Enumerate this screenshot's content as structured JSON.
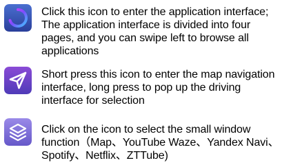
{
  "items": [
    {
      "icon": "app-launcher-icon",
      "lines": [
        "Click this icon to enter the application interface;",
        "The application interface is divided into four",
        "pages, and you can swipe left to browse all",
        "applications"
      ]
    },
    {
      "icon": "navigation-arrow-icon",
      "lines": [
        "Short press this icon to enter the map navigation",
        "interface, long press to pop up the driving",
        "interface for selection"
      ]
    },
    {
      "icon": "layers-icon",
      "lines": [
        "Click on the icon to select the small window",
        "function（Map、YouTube Waze、Yandex Navi、",
        "Spotify、Netflix、ZTTube)"
      ]
    }
  ]
}
